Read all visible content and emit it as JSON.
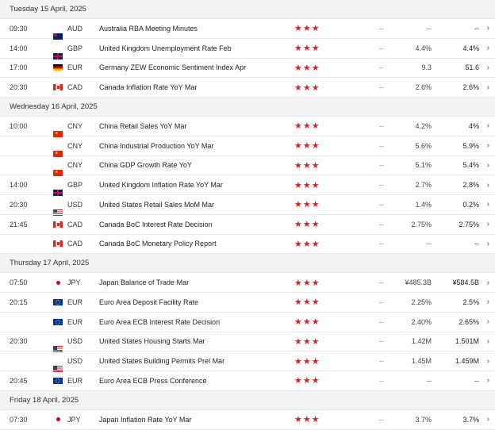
{
  "colors": {
    "stars": "#d9202a",
    "header_bg": "#f2f3f5"
  },
  "days": [
    {
      "label": "Tuesday 15 April, 2025",
      "rows": [
        {
          "time": "09:30",
          "flag": "au",
          "currency": "AUD",
          "event": "Australia RBA Meeting Minutes",
          "stars": "★★★",
          "actual": "--",
          "forecast": "--",
          "previous": "--",
          "chevron": "›"
        },
        {
          "time": "14:00",
          "flag": "gb",
          "currency": "GBP",
          "event": "United Kingdom Unemployment Rate Feb",
          "stars": "★★★",
          "actual": "--",
          "forecast": "4.4%",
          "previous": "4.4%",
          "chevron": "›"
        },
        {
          "time": "17:00",
          "flag": "de",
          "currency": "EUR",
          "event": "Germany ZEW Economic Sentiment Index Apr",
          "stars": "★★★",
          "actual": "--",
          "forecast": "9.3",
          "previous": "51.6",
          "chevron": "›"
        },
        {
          "time": "20:30",
          "flag": "ca",
          "currency": "CAD",
          "event": "Canada Inflation Rate YoY Mar",
          "stars": "★★★",
          "actual": "--",
          "forecast": "2.6%",
          "previous": "2.6%",
          "chevron": "›"
        }
      ]
    },
    {
      "label": "Wednesday 16 April, 2025",
      "rows": [
        {
          "time": "10:00",
          "flag": "cn",
          "currency": "CNY",
          "event": "China Retail Sales YoY Mar",
          "stars": "★★★",
          "actual": "--",
          "forecast": "4.2%",
          "previous": "4%",
          "chevron": "›"
        },
        {
          "time": "",
          "flag": "cn",
          "currency": "CNY",
          "event": "China Industrial Production YoY Mar",
          "stars": "★★★",
          "actual": "--",
          "forecast": "5.6%",
          "previous": "5.9%",
          "chevron": "›"
        },
        {
          "time": "",
          "flag": "cn",
          "currency": "CNY",
          "event": "China GDP Growth Rate YoY",
          "stars": "★★★",
          "actual": "--",
          "forecast": "5.1%",
          "previous": "5.4%",
          "chevron": "›"
        },
        {
          "time": "14:00",
          "flag": "gb",
          "currency": "GBP",
          "event": "United Kingdom Inflation Rate YoY Mar",
          "stars": "★★★",
          "actual": "--",
          "forecast": "2.7%",
          "previous": "2.8%",
          "chevron": "›"
        },
        {
          "time": "20:30",
          "flag": "us",
          "currency": "USD",
          "event": "United States Retail Sales MoM Mar",
          "stars": "★★★",
          "actual": "--",
          "forecast": "1.4%",
          "previous": "0.2%",
          "chevron": "›"
        },
        {
          "time": "21:45",
          "flag": "ca",
          "currency": "CAD",
          "event": "Canada BoC Interest Rate Decision",
          "stars": "★★★",
          "actual": "--",
          "forecast": "2.75%",
          "previous": "2.75%",
          "chevron": "›"
        },
        {
          "time": "",
          "flag": "ca",
          "currency": "CAD",
          "event": "Canada BoC Monetary Policy Report",
          "stars": "★★★",
          "actual": "--",
          "forecast": "--",
          "previous": "--",
          "chevron": "›"
        }
      ]
    },
    {
      "label": "Thursday 17 April, 2025",
      "rows": [
        {
          "time": "07:50",
          "flag": "jp",
          "currency": "JPY",
          "event": "Japan Balance of Trade Mar",
          "stars": "★★★",
          "actual": "--",
          "forecast": "¥485.3B",
          "previous": "¥584.5B",
          "chevron": "›"
        },
        {
          "time": "20:15",
          "flag": "eu",
          "currency": "EUR",
          "event": "Euro Area Deposit Facility Rate",
          "stars": "★★★",
          "actual": "--",
          "forecast": "2.25%",
          "previous": "2.5%",
          "chevron": "›"
        },
        {
          "time": "",
          "flag": "eu",
          "currency": "EUR",
          "event": "Euro Area ECB Interest Rate Decision",
          "stars": "★★★",
          "actual": "--",
          "forecast": "2.40%",
          "previous": "2.65%",
          "chevron": "›"
        },
        {
          "time": "20:30",
          "flag": "us",
          "currency": "USD",
          "event": "United States Housing Starts Mar",
          "stars": "★★★",
          "actual": "--",
          "forecast": "1.42M",
          "previous": "1.501M",
          "chevron": "›"
        },
        {
          "time": "",
          "flag": "us",
          "currency": "USD",
          "event": "United States Building Permits Prel Mar",
          "stars": "★★★",
          "actual": "--",
          "forecast": "1.45M",
          "previous": "1.459M",
          "chevron": "›"
        },
        {
          "time": "20:45",
          "flag": "eu",
          "currency": "EUR",
          "event": "Euro Area ECB Press Conference",
          "stars": "★★★",
          "actual": "--",
          "forecast": "--",
          "previous": "--",
          "chevron": "›"
        }
      ]
    },
    {
      "label": "Friday 18 April, 2025",
      "rows": [
        {
          "time": "07:30",
          "flag": "jp",
          "currency": "JPY",
          "event": "Japan Inflation Rate YoY Mar",
          "stars": "★★★",
          "actual": "--",
          "forecast": "3.7%",
          "previous": "3.7%",
          "chevron": "›"
        }
      ]
    }
  ]
}
